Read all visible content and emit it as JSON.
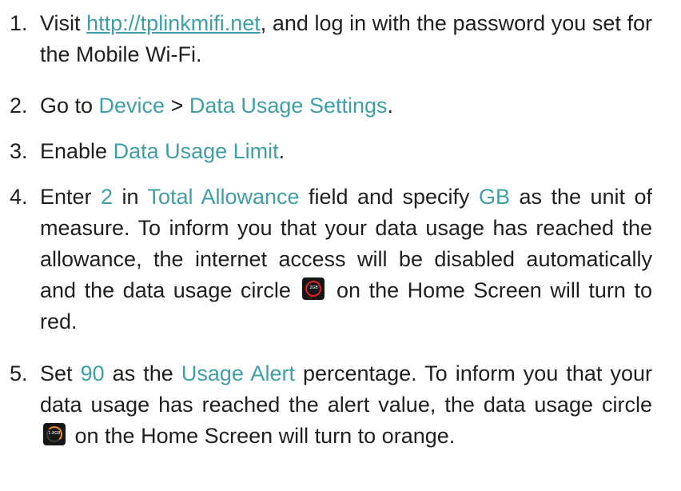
{
  "steps": [
    {
      "number": "1.",
      "pre": "Visit ",
      "link": "http://tplinkmifi.net",
      "post": ", and log in with the password you set for the Mobile Wi-Fi."
    },
    {
      "number": "2.",
      "pre": "Go to ",
      "hl1": "Device",
      "mid": " > ",
      "hl2": "Data Usage Settings",
      "post": "."
    },
    {
      "number": "3.",
      "pre": "Enable ",
      "hl1": "Data Usage Limit",
      "post": "."
    },
    {
      "number": "4.",
      "pre": "Enter ",
      "val": "2",
      "t1": " in ",
      "field": "Total Allowance",
      "t2": " field and specify ",
      "unit": "GB",
      "t3": " as the unit of measure. To inform you that your data usage has reached the allowance, the internet access will be disabled automatically and the data usage circle ",
      "icon_text": "2GB",
      "t4": " on the Home Screen will turn to red."
    },
    {
      "number": "5.",
      "pre": "Set ",
      "val": "90",
      "t1": " as the ",
      "field": "Usage Alert",
      "t2": " percentage. To inform you that your data usage has reached the alert value, the data usage circle ",
      "icon_text": "1.8GB",
      "t3": " on the Home Screen will turn to orange."
    }
  ],
  "colors": {
    "highlight": "#3f9fa6",
    "text": "#1f1f1f",
    "limit_ring": "#e02020",
    "alert_ring": "#f08a1c"
  },
  "icons": {
    "limit": "data-usage-circle-red-icon",
    "alert": "data-usage-circle-orange-icon"
  }
}
